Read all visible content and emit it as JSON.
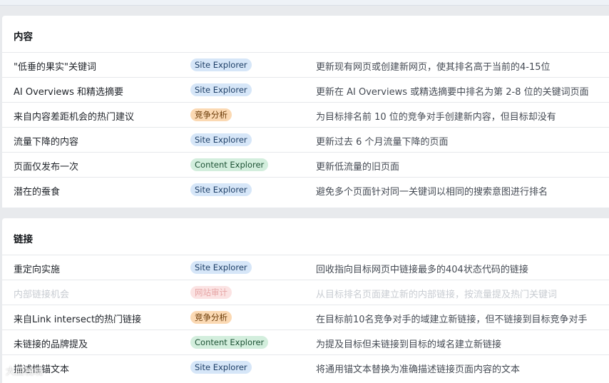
{
  "sections": [
    {
      "title": "内容",
      "rows": [
        {
          "name": "\"低垂的果实\"关键词",
          "tag": "Site Explorer",
          "tag_color": "blue",
          "desc": "更新现有网页或创建新网页，使其排名高于当前的4-15位"
        },
        {
          "name": "AI Overviews 和精选摘要",
          "tag": "Site Explorer",
          "tag_color": "blue",
          "desc": "更新在 AI Overviews 或精选摘要中排名为第 2-8 位的关键词页面"
        },
        {
          "name": "来自内容差距机会的热门建议",
          "tag": "竞争分析",
          "tag_color": "orange",
          "desc": "为目标排名前 10 位的竞争对手创建新内容，但目标却没有"
        },
        {
          "name": "流量下降的内容",
          "tag": "Site Explorer",
          "tag_color": "blue",
          "desc": "更新过去 6 个月流量下降的页面"
        },
        {
          "name": "页面仅发布一次",
          "tag": "Content Explorer",
          "tag_color": "green",
          "desc": "更新低流量的旧页面"
        },
        {
          "name": "潜在的蚕食",
          "tag": "Site Explorer",
          "tag_color": "blue",
          "desc": "避免多个页面针对同一关键词以相同的搜索意图进行排名"
        }
      ]
    },
    {
      "title": "链接",
      "rows": [
        {
          "name": "重定向实施",
          "tag": "Site Explorer",
          "tag_color": "blue",
          "desc": "回收指向目标网页中链接最多的404状态代码的链接"
        },
        {
          "name": "内部链接机会",
          "tag": "网站审计",
          "tag_color": "faded",
          "desc": "从目标排名页面建立新的内部链接，按流量提及热门关键词",
          "disabled": true
        },
        {
          "name": "来自Link intersect的热门链接",
          "tag": "竞争分析",
          "tag_color": "orange",
          "desc": "在目标前10名竞争对手的域建立新链接，但不链接到目标竞争对手"
        },
        {
          "name": "未链接的品牌提及",
          "tag": "Content Explorer",
          "tag_color": "green",
          "desc": "为提及目标但未链接到目标的域名建立新链接"
        },
        {
          "name": "描述性锚文本",
          "tag": "Site Explorer",
          "tag_color": "blue",
          "desc": "将通用锚文本替换为准确描述链接页面内容的文本"
        }
      ]
    }
  ],
  "watermark": "大曲视境"
}
